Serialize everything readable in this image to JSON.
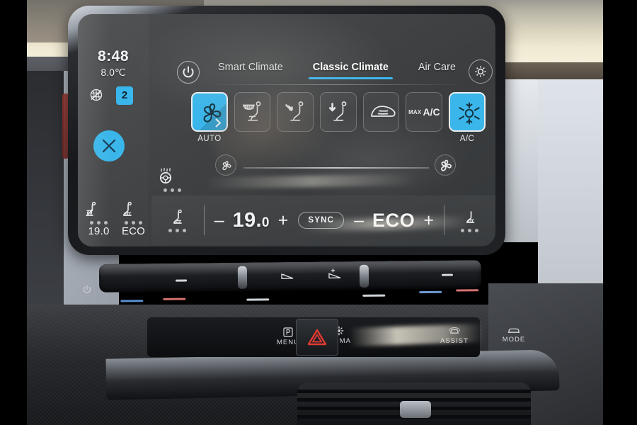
{
  "device": {
    "name": "vw-id3-climate-touchscreen"
  },
  "status_rail": {
    "clock": "8:48",
    "outside_temp": "8.0℃",
    "recirculation_icon": "recirculation-icon",
    "zone_badge": "2",
    "close_icon": "close-x-icon",
    "steering_wheel_heat_icon": "steering-wheel-heat-icon",
    "seat_left": {
      "icon": "seat-heat-icon",
      "label": "19.0",
      "label_small": "0",
      "dots": 3
    },
    "seat_right": {
      "icon": "seat-heat-icon",
      "label": "ECO",
      "dots": 3
    }
  },
  "header": {
    "power_icon": "power-icon",
    "settings_icon": "gear-icon",
    "tabs": [
      {
        "label": "Smart Climate",
        "active": false
      },
      {
        "label": "Classic Climate",
        "active": true
      },
      {
        "label": "Air Care",
        "active": false
      }
    ]
  },
  "function_buttons": [
    {
      "name": "auto-climate-button",
      "icon": "fan-icon",
      "caption": "AUTO",
      "active": true,
      "chevron": true
    },
    {
      "name": "windscreen-defrost-seat-button",
      "icon": "defrost-seat-icon",
      "caption": "",
      "active": false
    },
    {
      "name": "airflow-body-button",
      "icon": "airflow-body-icon",
      "caption": "",
      "active": false
    },
    {
      "name": "airflow-feet-button",
      "icon": "airflow-feet-icon",
      "caption": "",
      "active": false
    },
    {
      "name": "rear-window-defrost-button",
      "icon": "rear-defrost-icon",
      "caption": "",
      "active": false
    },
    {
      "name": "max-ac-button",
      "icon": "max-ac-text",
      "caption": "",
      "active": false,
      "text_small": "MAX",
      "text_large": "A/C"
    },
    {
      "name": "ac-button",
      "icon": "snowflake-icon",
      "caption": "A/C",
      "active": true
    }
  ],
  "fan_slider": {
    "min_icon": "fan-small-icon",
    "max_icon": "fan-large-icon",
    "value_percent": 0
  },
  "climate_bar": {
    "seat_center_icon": "seat-heat-icon",
    "temp_minus": "–",
    "temp_value": "19.",
    "temp_decimal": "0",
    "temp_plus": "+",
    "sync_label": "SYNC",
    "eco_minus": "–",
    "eco_value": "ECO",
    "eco_plus": "+",
    "seat_right_icon": "seat-heat-icon"
  },
  "hardware": {
    "power_icon": "power-icon",
    "slider_left_label": "temperature-slider-left",
    "slider_right_label": "temperature-slider-right",
    "volume_minus_icon": "volume-down-icon",
    "volume_plus_icon": "volume-up-icon",
    "buttons": [
      {
        "name": "menu-button",
        "icon": "park-p-icon",
        "label": "MENU"
      },
      {
        "name": "clima-button",
        "icon": "fan-gear-icon",
        "label": "CLIMA"
      },
      {
        "name": "hazard-button",
        "icon": "hazard-triangle-icon",
        "label": ""
      },
      {
        "name": "assist-button",
        "icon": "car-assist-icon",
        "label": "ASSIST"
      },
      {
        "name": "mode-button",
        "icon": "car-mode-icon",
        "label": "MODE"
      }
    ]
  },
  "colors": {
    "accent_blue": "#39b7ec",
    "hazard_red": "#e03a32",
    "text_primary": "#f2f3f4"
  }
}
